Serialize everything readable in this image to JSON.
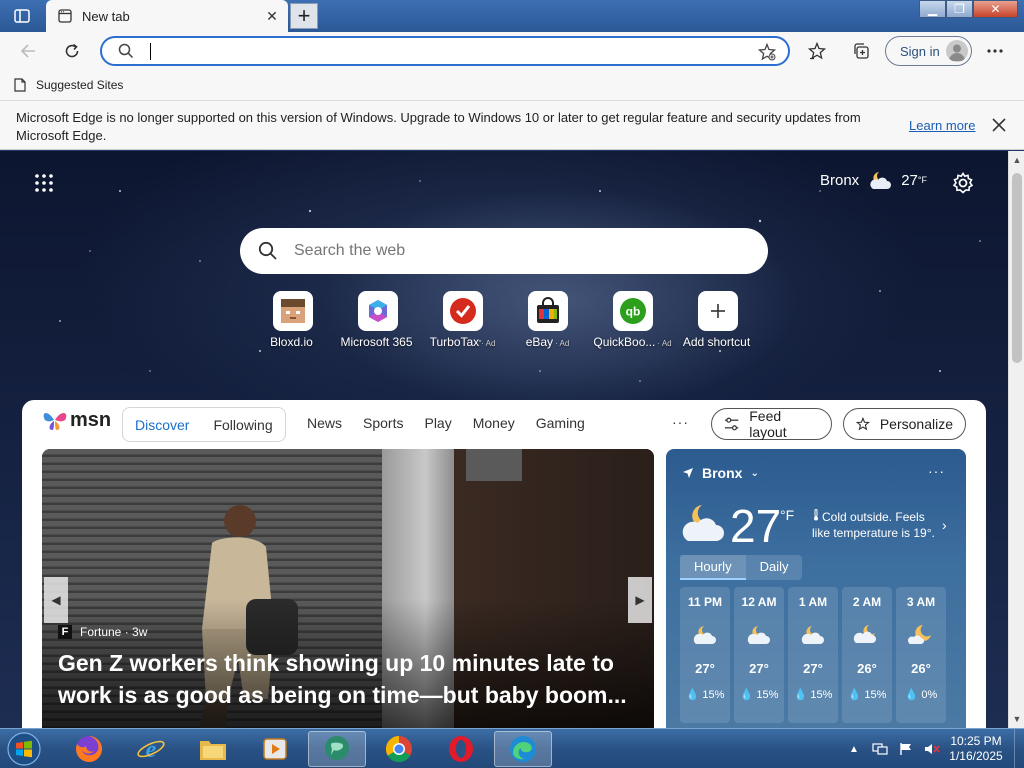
{
  "browser": {
    "tab_title": "New tab",
    "address_value": "",
    "signin_label": "Sign in",
    "favorites_label": "Suggested Sites"
  },
  "infobar": {
    "message": "Microsoft Edge is no longer supported on this version of Windows. Upgrade to Windows 10 or later to get regular feature and security updates from Microsoft Edge.",
    "link": "Learn more"
  },
  "newtab": {
    "weather": {
      "location": "Bronx",
      "temp": "27",
      "unit": "°F"
    },
    "search_placeholder": "Search the web",
    "shortcuts": [
      {
        "label": "Bloxd.io",
        "ad": ""
      },
      {
        "label": "Microsoft 365",
        "ad": ""
      },
      {
        "label": "TurboTax",
        "ad": "· Ad"
      },
      {
        "label": "eBay",
        "ad": "· Ad"
      },
      {
        "label": "QuickBoo...",
        "ad": "· Ad"
      },
      {
        "label": "Add shortcut",
        "ad": ""
      }
    ]
  },
  "feed": {
    "brand": "msn",
    "tabs": [
      "Discover",
      "Following"
    ],
    "nav": [
      "News",
      "Sports",
      "Play",
      "Money",
      "Gaming"
    ],
    "more": "···",
    "feed_layout": "Feed layout",
    "personalize": "Personalize",
    "hero": {
      "source": "Fortune",
      "age": "· 3w",
      "headline": "Gen Z workers think showing up 10 minutes late to work is as good as being on time—but baby boom..."
    },
    "weather_card": {
      "location": "Bronx",
      "temp": "27",
      "unit": "°F",
      "summary": "Cold outside. Feels like temperature is 19°.",
      "tabs": [
        "Hourly",
        "Daily"
      ],
      "hours": [
        {
          "time": "11 PM",
          "temp": "27°",
          "precip": "15%"
        },
        {
          "time": "12 AM",
          "temp": "27°",
          "precip": "15%"
        },
        {
          "time": "1 AM",
          "temp": "27°",
          "precip": "15%"
        },
        {
          "time": "2 AM",
          "temp": "26°",
          "precip": "15%"
        },
        {
          "time": "3 AM",
          "temp": "26°",
          "precip": "0%"
        }
      ]
    }
  },
  "taskbar": {
    "time": "10:25 PM",
    "date": "1/16/2025"
  },
  "colors": {
    "accent": "#1a6fc9",
    "address_border": "#2b6fd1",
    "taskbar": "#2a5285"
  }
}
